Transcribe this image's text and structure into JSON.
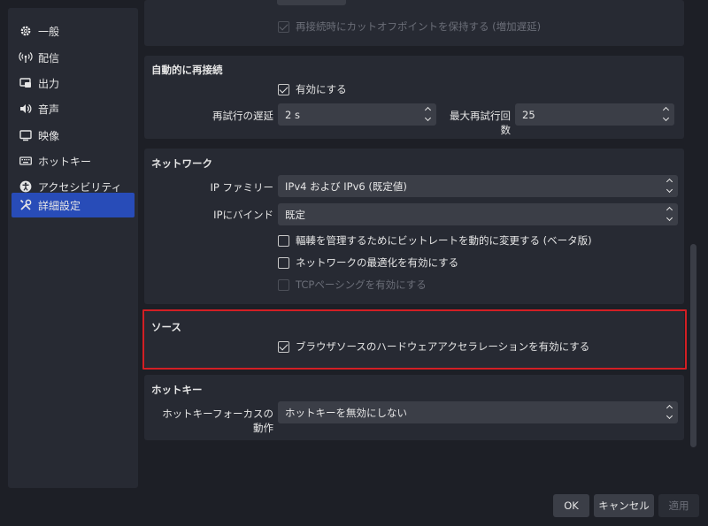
{
  "sidebar": {
    "items": [
      {
        "label": "一般",
        "icon": "gear-icon"
      },
      {
        "label": "配信",
        "icon": "broadcast-icon"
      },
      {
        "label": "出力",
        "icon": "output-icon"
      },
      {
        "label": "音声",
        "icon": "speaker-icon"
      },
      {
        "label": "映像",
        "icon": "monitor-icon"
      },
      {
        "label": "ホットキー",
        "icon": "keyboard-icon"
      },
      {
        "label": "アクセシビリティ",
        "icon": "accessibility-icon"
      },
      {
        "label": "詳細設定",
        "icon": "tools-icon"
      }
    ],
    "active_index": 7
  },
  "top_group": {
    "keep_cutoff_label": "再接続時にカットオフポイントを保持する (増加遅延)"
  },
  "reconnect": {
    "title": "自動的に再接続",
    "enable_label": "有効にする",
    "retry_delay_label": "再試行の遅延",
    "retry_delay_value": "2 s",
    "max_retries_label": "最大再試行回数",
    "max_retries_value": "25"
  },
  "network": {
    "title": "ネットワーク",
    "ip_family_label": "IP ファミリー",
    "ip_family_value": "IPv4 および IPv6 (既定値)",
    "bind_ip_label": "IPにバインド",
    "bind_ip_value": "既定",
    "dynamic_bitrate_label": "輻輳を管理するためにビットレートを動的に変更する (ベータ版)",
    "optimize_label": "ネットワークの最適化を有効にする",
    "tcp_pacing_label": "TCPペーシングを有効にする"
  },
  "sources": {
    "title": "ソース",
    "browser_hw_accel_label": "ブラウザソースのハードウェアアクセラレーションを有効にする"
  },
  "hotkeys": {
    "title": "ホットキー",
    "focus_behavior_label": "ホットキーフォーカスの動作",
    "focus_behavior_value": "ホットキーを無効にしない"
  },
  "buttons": {
    "ok": "OK",
    "cancel": "キャンセル",
    "apply": "適用"
  },
  "colors": {
    "accent": "#284cb8",
    "highlight_border": "#d31f24",
    "panel": "#272a33",
    "background": "#1d1f26"
  }
}
